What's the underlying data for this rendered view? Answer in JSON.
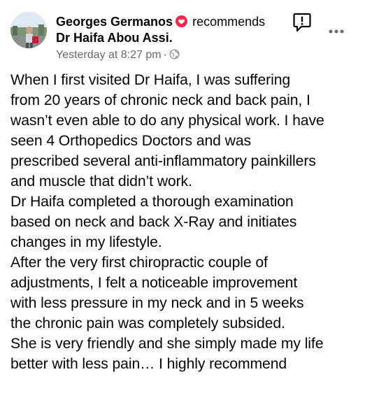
{
  "post": {
    "author": "Georges Germanos",
    "action": "recommends",
    "page": "Dr Haifa Abou Assi.",
    "timestamp": "Yesterday at 8:27 pm",
    "separator": "·",
    "icons": {
      "recommendation": "recommend-icon",
      "privacy": "globe-icon",
      "report": "report-icon",
      "more": "more-options-icon"
    },
    "colors": {
      "text": "#050505",
      "secondary": "#65676b",
      "recommend": "#f02849"
    },
    "body_lines": [
      "When I first visited Dr Haifa, I was suffering",
      "from 20 years of chronic neck and back pain, I",
      "wasn’t even able to do any physical work. I have",
      "seen 4 Orthopedics Doctors and was",
      "prescribed several anti-inflammatory painkillers",
      "and muscle that didn’t work.",
      "Dr Haifa completed a thorough examination",
      "based on neck and back X-Ray and initiates",
      "changes in my lifestyle.",
      "After the very first chiropractic couple of",
      "adjustments, I felt a noticeable improvement",
      "with less pressure in my neck and in 5 weeks",
      "the chronic pain was completely subsided.",
      "She is very friendly and she simply made my life",
      "better with less pain… I highly recommend"
    ]
  }
}
